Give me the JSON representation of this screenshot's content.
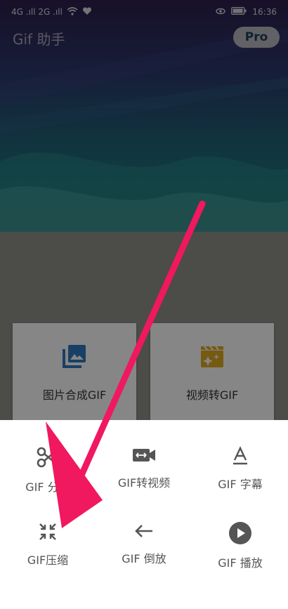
{
  "status_bar": {
    "left": "4G .ıll 2G .ıll",
    "time": "16:36"
  },
  "app": {
    "title": "Gif 助手",
    "pro_label": "Pro"
  },
  "cards": [
    {
      "label": "图片合成GIF",
      "icon": "image-gallery-icon",
      "color": "#2f74b8"
    },
    {
      "label": "视频转GIF",
      "icon": "movie-sparkle-icon",
      "color": "#d7a422"
    }
  ],
  "sheet": {
    "items": [
      {
        "label": "GIF 分割",
        "icon": "scissors-icon"
      },
      {
        "label": "GIF转视频",
        "icon": "video-camera-icon"
      },
      {
        "label": "GIF 字幕",
        "icon": "text-format-icon"
      },
      {
        "label": "GIF压缩",
        "icon": "compress-icon"
      },
      {
        "label": "GIF 倒放",
        "icon": "arrow-left-icon"
      },
      {
        "label": "GIF 播放",
        "icon": "play-circle-icon"
      }
    ]
  },
  "colors": {
    "overlay_arrow": "#f0185f",
    "icon_gray": "#555555"
  }
}
